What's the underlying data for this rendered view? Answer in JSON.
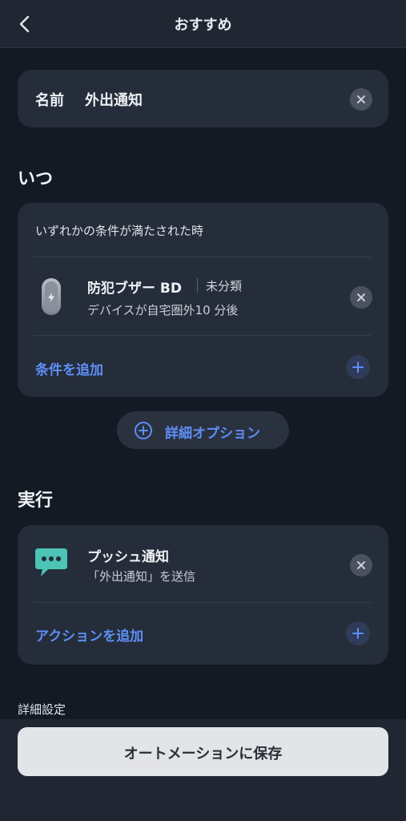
{
  "header": {
    "title": "おすすめ",
    "back_icon": "chevron-left-icon"
  },
  "name_card": {
    "label": "名前",
    "value": "外出通知",
    "clear_icon": "close-icon"
  },
  "when_section": {
    "title": "いつ",
    "condition_header": "いずれかの条件が満たされた時",
    "device": {
      "name": "防犯ブザー BD",
      "category": "未分類",
      "description": "デバイスが自宅圏外10 分後",
      "icon": "security-buzzer-icon"
    },
    "add_condition_label": "条件を追加",
    "add_icon": "plus-icon"
  },
  "detail_options": {
    "label": "詳細オプション",
    "icon": "plus-circle-icon"
  },
  "exec_section": {
    "title": "実行",
    "action": {
      "name": "プッシュ通知",
      "description": "「外出通知」を送信",
      "icon": "chat-bubble-icon"
    },
    "add_action_label": "アクションを追加"
  },
  "advanced_settings_label": "詳細設定",
  "footer": {
    "save_label": "オートメーションに保存"
  },
  "colors": {
    "background": "#131a24",
    "card": "#252d3a",
    "accent": "#5e8ef5",
    "chat_icon": "#4cc3b4",
    "save_button": "#e3e4e7"
  }
}
